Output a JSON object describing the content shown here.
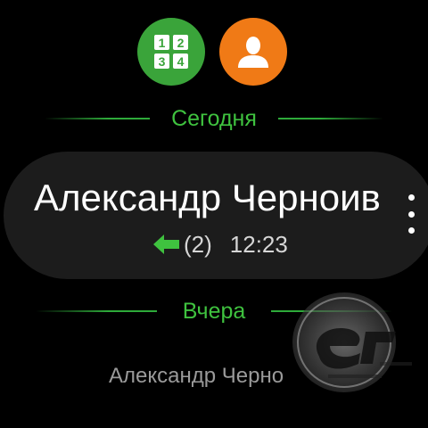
{
  "quick_actions": {
    "keypad_icon": "keypad-icon",
    "contacts_icon": "contact-person-icon",
    "keypad_digits": [
      "1",
      "2",
      "3",
      "4"
    ]
  },
  "sections": {
    "today": "Сегодня",
    "yesterday": "Вчера"
  },
  "current_call": {
    "name": "Александр Черноив",
    "direction_icon": "incoming-arrow-icon",
    "count": "(2)",
    "time": "12:23"
  },
  "more_icon": "more-vertical-icon",
  "yesterday_item": {
    "name": "Александр Черно"
  },
  "colors": {
    "accent_green": "#3fc23f",
    "keypad_bg": "#3aa43a",
    "contacts_bg": "#f07a16",
    "card_bg": "#1c1c1c",
    "background": "#000000"
  }
}
